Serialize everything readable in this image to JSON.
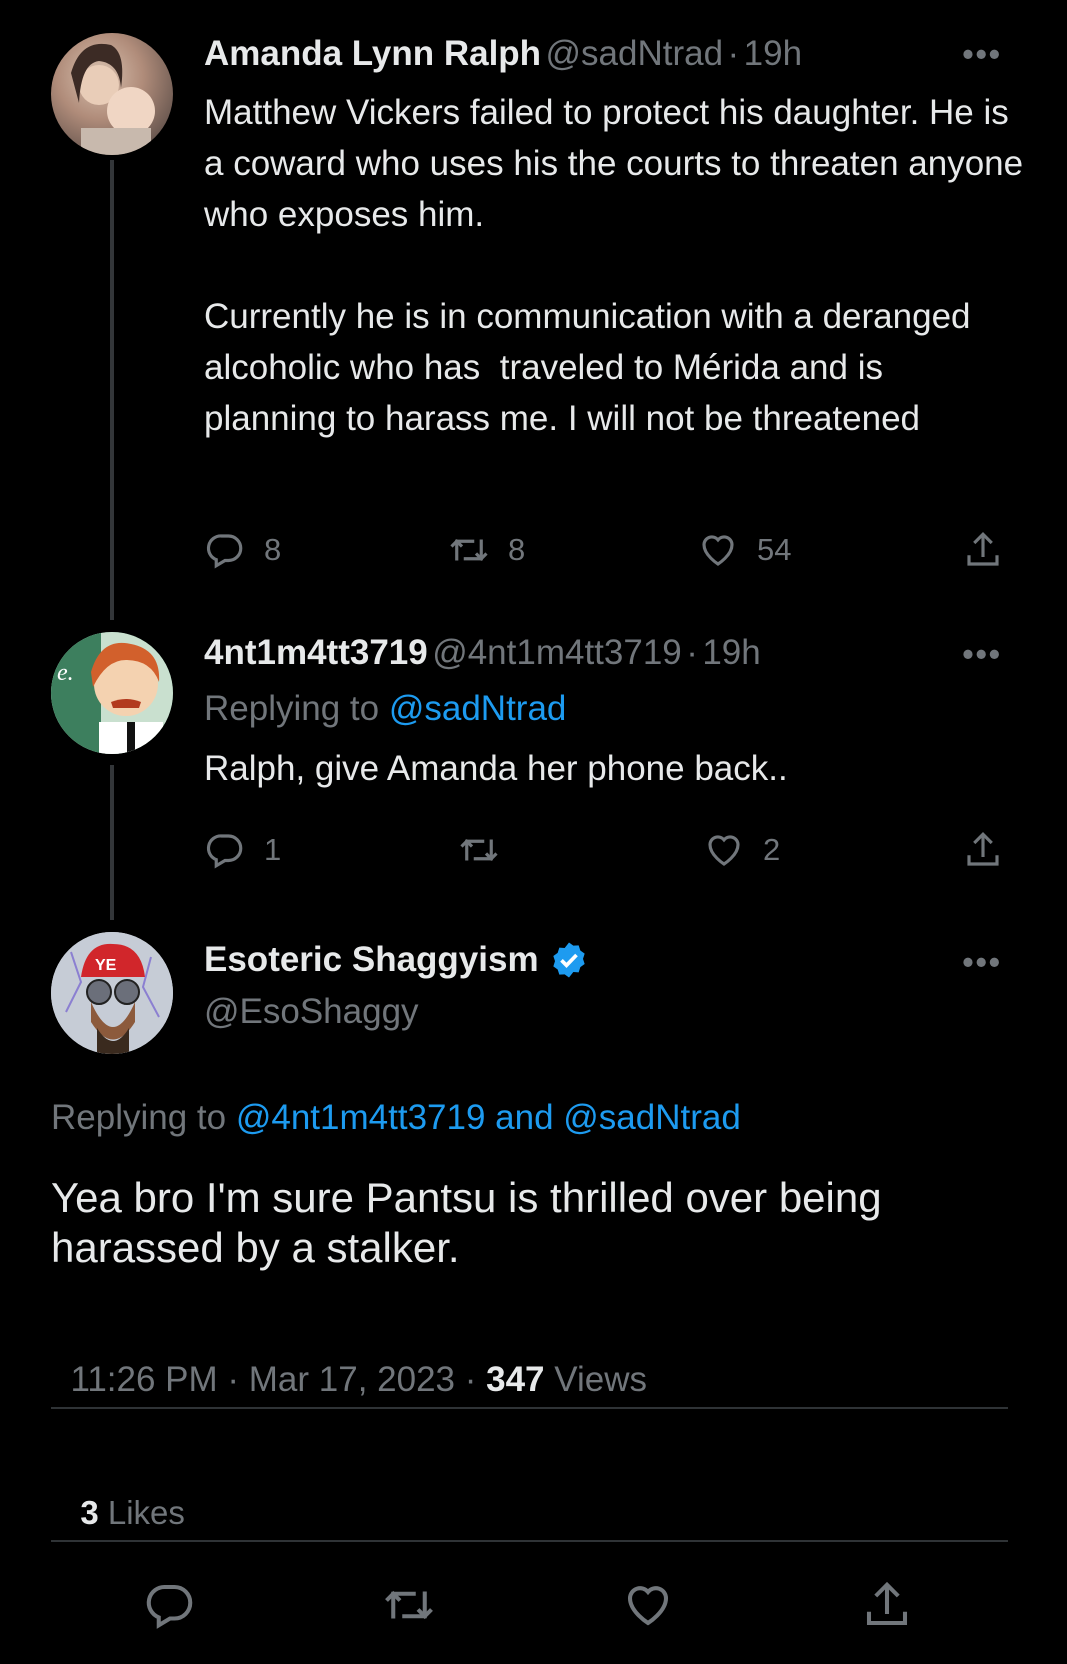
{
  "tweets": [
    {
      "name": "Amanda Lynn Ralph",
      "handle": "@sadNtrad",
      "sep": "·",
      "time": "19h",
      "text": "Matthew Vickers failed to protect his daughter. He is a coward who uses his the courts to threaten anyone who exposes him.\n\nCurrently he is in communication with a deranged alcoholic who has  traveled to Mérida and is planning to harass me. I will not be threatened",
      "replies": "8",
      "retweets": "8",
      "likes": "54"
    },
    {
      "name": "4nt1m4tt3719",
      "handle": "@4nt1m4tt3719",
      "sep": "·",
      "time": "19h",
      "replying_label": "Replying to",
      "replying_to": "@sadNtrad",
      "text": "Ralph, give Amanda her phone back..",
      "replies": "1",
      "retweets": "",
      "likes": "2"
    }
  ],
  "main": {
    "name": "Esoteric Shaggyism",
    "handle": "@EsoShaggy",
    "replying_label": "Replying to",
    "replying_to": "@4nt1m4tt3719 and @sadNtrad",
    "text": "Yea bro I'm sure Pantsu is thrilled over being harassed by a stalker.",
    "timestamp": "11:26 PM · Mar 17, 2023 · ",
    "views_count": "347",
    "views_label": " Views",
    "likes_count": "3",
    "likes_label": " Likes"
  },
  "colors": {
    "background": "#000000",
    "text": "#e7e9ea",
    "muted": "#71767b",
    "link": "#1d9bf0",
    "verified": "#1d9bf0"
  },
  "icons": [
    "reply-icon",
    "retweet-icon",
    "like-icon",
    "share-icon",
    "more-icon",
    "verified-badge-icon"
  ]
}
